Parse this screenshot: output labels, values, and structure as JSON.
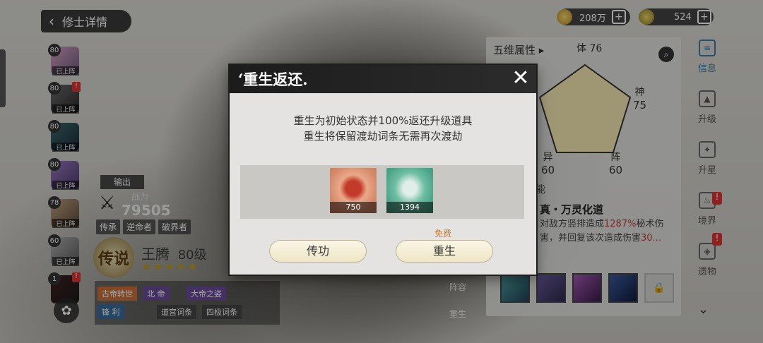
{
  "header": {
    "back_label": "修士详情",
    "currency": [
      {
        "name": "spirit-stone",
        "value": "208万"
      },
      {
        "name": "jade",
        "value": "524"
      }
    ]
  },
  "roster": [
    {
      "level": "80",
      "status": "已上阵",
      "warn": false
    },
    {
      "level": "80",
      "status": "已上阵",
      "warn": true
    },
    {
      "level": "80",
      "status": "已上阵",
      "warn": false
    },
    {
      "level": "80",
      "status": "已上阵",
      "warn": false
    },
    {
      "level": "78",
      "status": "已上阵",
      "warn": false
    },
    {
      "level": "60",
      "status": "已上阵",
      "warn": false
    },
    {
      "level": "1",
      "status": "",
      "warn": true
    }
  ],
  "character": {
    "role": "输出",
    "power_label": "战力",
    "power": "79505",
    "traits": [
      "传承",
      "逆命者",
      "破界者"
    ],
    "badge": "传说",
    "name": "王腾",
    "level": "80级",
    "stars": "★★★★★",
    "tags": [
      "古帝转世",
      "北 帝",
      "大帝之姿",
      "锋 利",
      "道宫词条",
      "四极词条"
    ]
  },
  "right_panel": {
    "title": "五维属性 ▸",
    "stats": [
      {
        "label": "体",
        "value": "76"
      },
      {
        "label": "神",
        "value": "75"
      },
      {
        "label": "异",
        "value": "60"
      },
      {
        "label": "阵",
        "value": "60"
      }
    ],
    "ability_label": "能",
    "skill_title": "真・万灵化道",
    "skill_desc_pre": "对敌方竖排造成",
    "skill_desc_pct": "1287%",
    "skill_desc_mid": "秘术伤害，并回复该次造成伤害",
    "skill_desc_num": "30..."
  },
  "vnav": [
    "信息",
    "升级",
    "升星",
    "境界",
    "遗物"
  ],
  "mid_labels": [
    "阵容",
    "重生"
  ],
  "dialog": {
    "title": "‘重生返还.",
    "line1": "重生为初始状态并100%返还升级道具",
    "line2": "重生将保留渡劫词条无需再次渡劫",
    "items": [
      {
        "name": "red-orb",
        "qty": "750"
      },
      {
        "name": "jade-egg",
        "qty": "1394"
      }
    ],
    "free_label": "免费",
    "btn_left": "传功",
    "btn_right": "重生"
  }
}
